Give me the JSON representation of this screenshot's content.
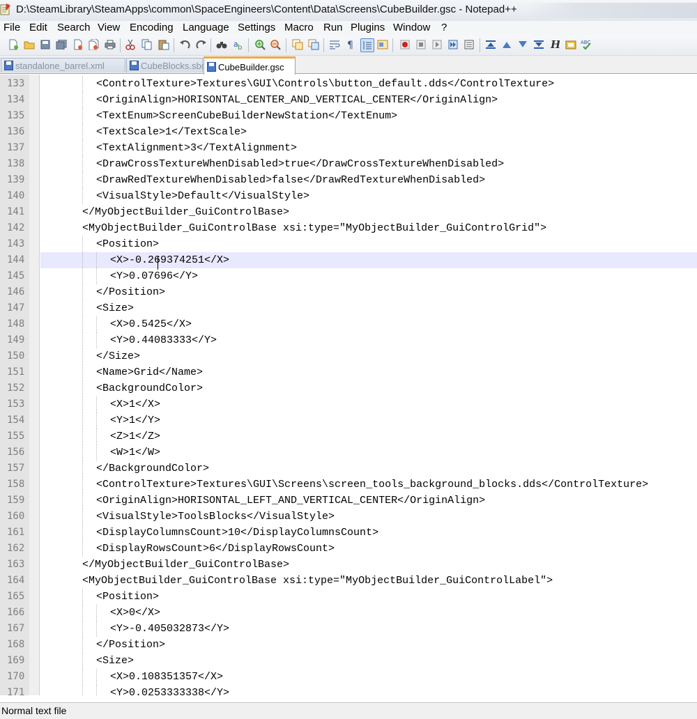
{
  "window": {
    "title": "D:\\SteamLibrary\\SteamApps\\common\\SpaceEngineers\\Content\\Data\\Screens\\CubeBuilder.gsc - Notepad++"
  },
  "menu": [
    "File",
    "Edit",
    "Search",
    "View",
    "Encoding",
    "Language",
    "Settings",
    "Macro",
    "Run",
    "Plugins",
    "Window",
    "?"
  ],
  "toolbar": {
    "icons": [
      "new-file-icon",
      "open-file-icon",
      "save-icon",
      "save-all-icon",
      "close-icon",
      "close-all-icon",
      "print-icon",
      "cut-icon",
      "copy-icon",
      "paste-icon",
      "undo-icon",
      "redo-icon",
      "find-icon",
      "replace-icon",
      "zoom-in-icon",
      "zoom-out-icon",
      "sync-vertical-icon",
      "sync-horizontal-icon",
      "word-wrap-icon",
      "show-all-characters-icon",
      "indent-guide-icon",
      "user-defined-language-icon",
      "record-macro-icon",
      "stop-recording-icon",
      "playback-macro-icon",
      "run-macro-multiple-icon",
      "save-macro-icon",
      "fold-all-icon",
      "move-up-icon",
      "move-down-icon",
      "unfold-all-icon",
      "heading-icon",
      "document-map-icon",
      "spell-check-icon"
    ]
  },
  "tabs": [
    {
      "label": "standalone_barrel.xml",
      "active": false
    },
    {
      "label": "CubeBlocks.sbc",
      "active": false
    },
    {
      "label": "CubeBuilder.gsc",
      "active": true
    }
  ],
  "editor": {
    "current_line": 144,
    "lines": [
      {
        "n": "133",
        "indent": 4,
        "text": "<ControlTexture>Textures\\GUI\\Controls\\button_default.dds</ControlTexture>"
      },
      {
        "n": "134",
        "indent": 4,
        "text": "<OriginAlign>HORISONTAL_CENTER_AND_VERTICAL_CENTER</OriginAlign>"
      },
      {
        "n": "135",
        "indent": 4,
        "text": "<TextEnum>ScreenCubeBuilderNewStation</TextEnum>"
      },
      {
        "n": "136",
        "indent": 4,
        "text": "<TextScale>1</TextScale>"
      },
      {
        "n": "137",
        "indent": 4,
        "text": "<TextAlignment>3</TextAlignment>"
      },
      {
        "n": "138",
        "indent": 4,
        "text": "<DrawCrossTextureWhenDisabled>true</DrawCrossTextureWhenDisabled>"
      },
      {
        "n": "139",
        "indent": 4,
        "text": "<DrawRedTextureWhenDisabled>false</DrawRedTextureWhenDisabled>"
      },
      {
        "n": "140",
        "indent": 4,
        "text": "<VisualStyle>Default</VisualStyle>"
      },
      {
        "n": "141",
        "indent": 3,
        "text": "</MyObjectBuilder_GuiControlBase>"
      },
      {
        "n": "142",
        "indent": 3,
        "text": "<MyObjectBuilder_GuiControlBase xsi:type=\"MyObjectBuilder_GuiControlGrid\">"
      },
      {
        "n": "143",
        "indent": 4,
        "text": "<Position>"
      },
      {
        "n": "144",
        "indent": 5,
        "text": "<X>-0.269374251</X>"
      },
      {
        "n": "145",
        "indent": 5,
        "text": "<Y>0.07696</Y>"
      },
      {
        "n": "146",
        "indent": 4,
        "text": "</Position>"
      },
      {
        "n": "147",
        "indent": 4,
        "text": "<Size>"
      },
      {
        "n": "148",
        "indent": 5,
        "text": "<X>0.5425</X>"
      },
      {
        "n": "149",
        "indent": 5,
        "text": "<Y>0.44083333</Y>"
      },
      {
        "n": "150",
        "indent": 4,
        "text": "</Size>"
      },
      {
        "n": "151",
        "indent": 4,
        "text": "<Name>Grid</Name>"
      },
      {
        "n": "152",
        "indent": 4,
        "text": "<BackgroundColor>"
      },
      {
        "n": "153",
        "indent": 5,
        "text": "<X>1</X>"
      },
      {
        "n": "154",
        "indent": 5,
        "text": "<Y>1</Y>"
      },
      {
        "n": "155",
        "indent": 5,
        "text": "<Z>1</Z>"
      },
      {
        "n": "156",
        "indent": 5,
        "text": "<W>1</W>"
      },
      {
        "n": "157",
        "indent": 4,
        "text": "</BackgroundColor>"
      },
      {
        "n": "158",
        "indent": 4,
        "text": "<ControlTexture>Textures\\GUI\\Screens\\screen_tools_background_blocks.dds</ControlTexture>"
      },
      {
        "n": "159",
        "indent": 4,
        "text": "<OriginAlign>HORISONTAL_LEFT_AND_VERTICAL_CENTER</OriginAlign>"
      },
      {
        "n": "160",
        "indent": 4,
        "text": "<VisualStyle>ToolsBlocks</VisualStyle>"
      },
      {
        "n": "161",
        "indent": 4,
        "text": "<DisplayColumnsCount>10</DisplayColumnsCount>"
      },
      {
        "n": "162",
        "indent": 4,
        "text": "<DisplayRowsCount>6</DisplayRowsCount>"
      },
      {
        "n": "163",
        "indent": 3,
        "text": "</MyObjectBuilder_GuiControlBase>"
      },
      {
        "n": "164",
        "indent": 3,
        "text": "<MyObjectBuilder_GuiControlBase xsi:type=\"MyObjectBuilder_GuiControlLabel\">"
      },
      {
        "n": "165",
        "indent": 4,
        "text": "<Position>"
      },
      {
        "n": "166",
        "indent": 5,
        "text": "<X>0</X>"
      },
      {
        "n": "167",
        "indent": 5,
        "text": "<Y>-0.405032873</Y>"
      },
      {
        "n": "168",
        "indent": 4,
        "text": "</Position>"
      },
      {
        "n": "169",
        "indent": 4,
        "text": "<Size>"
      },
      {
        "n": "170",
        "indent": 5,
        "text": "<X>0.108351357</X>"
      },
      {
        "n": "171",
        "indent": 5,
        "text": "<Y>0.0253333338</Y>"
      }
    ]
  },
  "status": {
    "file_type": "Normal text file"
  }
}
